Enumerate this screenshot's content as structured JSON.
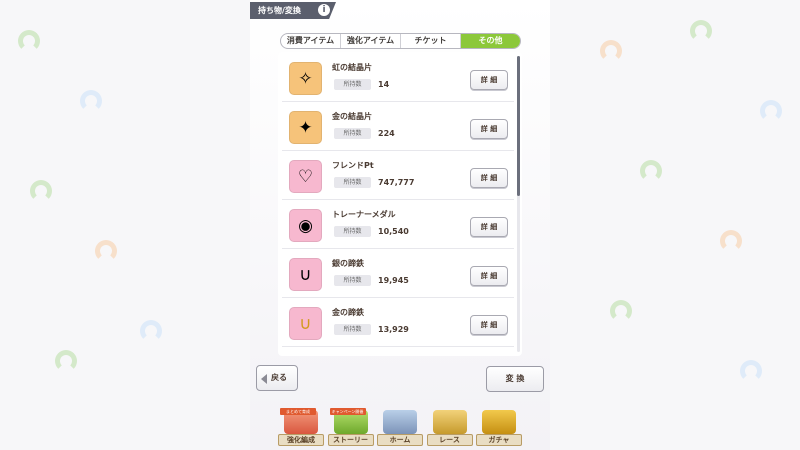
{
  "header": {
    "title": "持ち物/変換",
    "info_icon": "i"
  },
  "tabs": [
    {
      "label": "消費アイテム",
      "active": false
    },
    {
      "label": "強化アイテム",
      "active": false
    },
    {
      "label": "チケット",
      "active": false
    },
    {
      "label": "その他",
      "active": true
    }
  ],
  "items": [
    {
      "name": "虹の結晶片",
      "count_label": "所持数",
      "count": "14",
      "detail_label": "詳 細",
      "icon": "rainbow-crystal-icon",
      "icon_bg": "#f6c37a"
    },
    {
      "name": "金の結晶片",
      "count_label": "所持数",
      "count": "224",
      "detail_label": "詳 細",
      "icon": "gold-crystal-icon",
      "icon_bg": "#f6c37a"
    },
    {
      "name": "フレンドPt",
      "count_label": "所持数",
      "count": "747,777",
      "detail_label": "詳 細",
      "icon": "friend-point-icon",
      "icon_bg": "#f7b8cf"
    },
    {
      "name": "トレーナーメダル",
      "count_label": "所持数",
      "count": "10,540",
      "detail_label": "詳 細",
      "icon": "trainer-medal-icon",
      "icon_bg": "#f7b8cf"
    },
    {
      "name": "銀の蹄鉄",
      "count_label": "所持数",
      "count": "19,945",
      "detail_label": "詳 細",
      "icon": "silver-horseshoe-icon",
      "icon_bg": "#f7b8cf"
    },
    {
      "name": "金の蹄鉄",
      "count_label": "所持数",
      "count": "13,929",
      "detail_label": "詳 細",
      "icon": "gold-horseshoe-icon",
      "icon_bg": "#f7b8cf"
    }
  ],
  "buttons": {
    "back": "戻る",
    "exchange": "変 換"
  },
  "footer_nav": [
    {
      "label": "強化編成",
      "badge": "まとめて育成"
    },
    {
      "label": "ストーリー",
      "badge": "キャンペーン開催"
    },
    {
      "label": "ホーム",
      "badge": ""
    },
    {
      "label": "レース",
      "badge": ""
    },
    {
      "label": "ガチャ",
      "badge": ""
    }
  ],
  "colors": {
    "accent": "#8cc83a",
    "text": "#4a3b32"
  }
}
